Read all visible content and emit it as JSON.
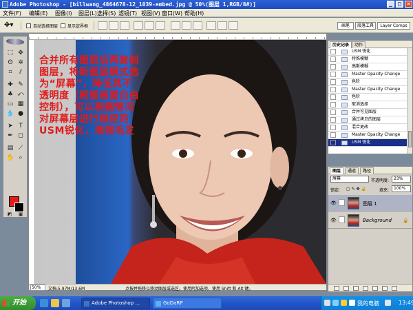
{
  "window": {
    "title": "Adobe Photoshop - [billwang_4864678-12_1039-embed.jpg @ 50%(图层 1,RGB/8#)]",
    "controls": [
      "_",
      "□",
      "×"
    ]
  },
  "menu": [
    "文件(F)",
    "编辑(E)",
    "图像(I)",
    "图层(L)",
    "选择(S)",
    "滤镜(T)",
    "视图(V)",
    "窗口(W)",
    "帮助(H)"
  ],
  "options_bar": {
    "tool_icon": "move-tool-icon",
    "auto_select_layer": "自动选择图层",
    "show_bounding_box": "显示定界框"
  },
  "palette_well": [
    "画笔",
    "段落工具",
    "Layer Comps"
  ],
  "toolbox": {
    "tools": [
      "move",
      "marquee",
      "lasso",
      "magic-wand",
      "crop",
      "slice",
      "healing",
      "brush",
      "clone-stamp",
      "history-brush",
      "eraser",
      "gradient",
      "blur",
      "dodge",
      "path-select",
      "type",
      "pen",
      "shape",
      "notes",
      "eyedropper",
      "hand",
      "zoom"
    ],
    "foreground_color": "#e31b1b",
    "background_color": "#000000"
  },
  "document": {
    "note": "合并所有图层后再复制图层，将新图层模式选为“屏幕”，降低其不透明度（根据画面自由控制），可以根据情况对屏幕层进行相应的USM锐化，增强毛发",
    "zoom": "50%",
    "doc_size": "文档:5.97M/13.6M",
    "status_hint": "点按并拖移以移动图层或选区。使用附加选项，使用 Shift 和 Alt 键。"
  },
  "history_panel": {
    "tabs": [
      "历史记录",
      "动作"
    ],
    "items": [
      {
        "label": "USM 锐化",
        "selected": false
      },
      {
        "label": "特殊模糊",
        "selected": false
      },
      {
        "label": "高斯模糊",
        "selected": false
      },
      {
        "label": "Master Opacity Change",
        "selected": false
      },
      {
        "label": "色阶",
        "selected": false
      },
      {
        "label": "Master Opacity Change",
        "selected": false
      },
      {
        "label": "色阶",
        "selected": false
      },
      {
        "label": "取消选择",
        "selected": false
      },
      {
        "label": "合并可见图层",
        "selected": false
      },
      {
        "label": "通过拷贝的图层",
        "selected": false
      },
      {
        "label": "混合更改",
        "selected": false
      },
      {
        "label": "Master Opacity Change",
        "selected": false
      },
      {
        "label": "USM 锐化",
        "selected": true
      }
    ]
  },
  "layers_panel": {
    "tabs": [
      "图层",
      "通道",
      "路径"
    ],
    "blend_mode": "屏幕",
    "opacity_label": "不透明度:",
    "opacity_value": "23%",
    "lock_label": "锁定:",
    "fill_label": "填充:",
    "fill_value": "100%",
    "layers": [
      {
        "name": "图层 1",
        "active": true
      },
      {
        "name": "Background",
        "active": false
      }
    ]
  },
  "taskbar": {
    "start_label": "开始",
    "tasks": [
      "Adobe Photoshop ...",
      "GoDaRP"
    ],
    "tray_label": "我的电脑",
    "clock": "13:49"
  }
}
